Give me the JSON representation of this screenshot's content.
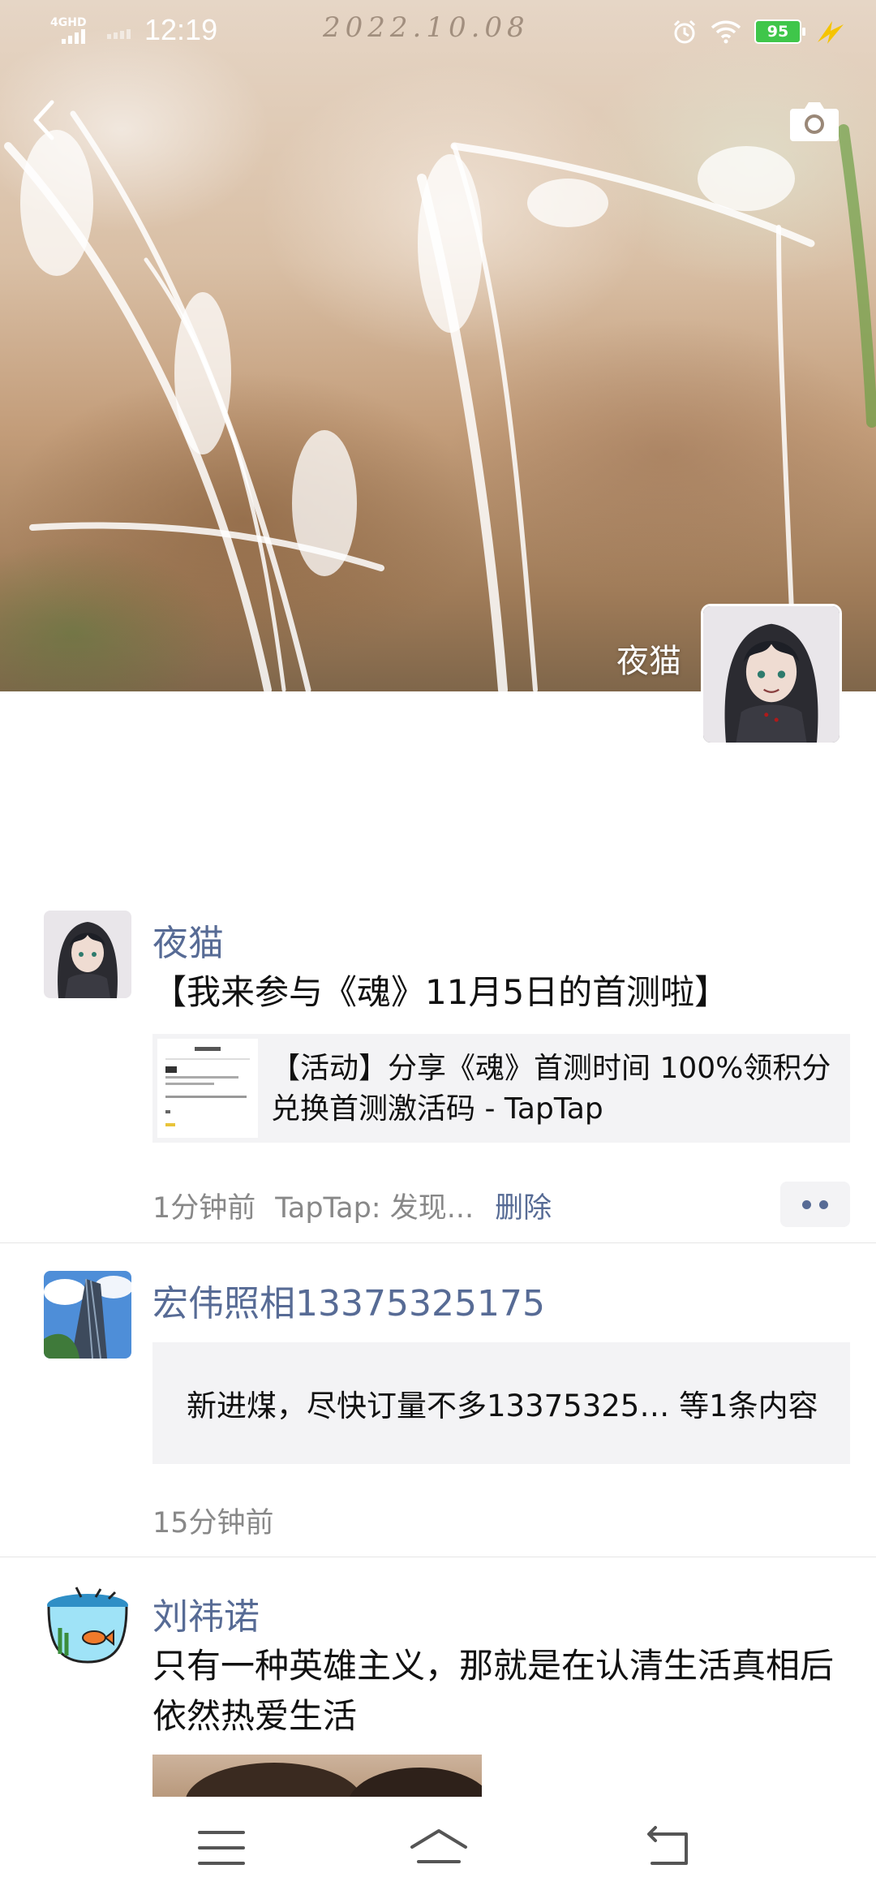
{
  "status_bar": {
    "network_type": "4GHD",
    "time": "12:19",
    "watermark_date": "2022.10.08",
    "battery_level": "95",
    "icons": [
      "signal-icon",
      "alarm-icon",
      "wifi-icon",
      "battery-icon",
      "charging-icon"
    ]
  },
  "header": {
    "back_icon": "chevron-left-icon",
    "camera_icon": "camera-icon",
    "owner_name": "夜猫"
  },
  "posts": [
    {
      "nickname": "夜猫",
      "text": "【我来参与《魂》11月5日的首测啦】",
      "link_card": {
        "title": "【活动】分享《魂》首测时间 100%领积分兑换首测激活码 - TapTap"
      },
      "time": "1分钟前",
      "source": "TapTap: 发现...",
      "delete_label": "删除"
    },
    {
      "nickname": "宏伟照相13375325175",
      "summary": "新进煤，尽快订量不多13375325… 等1条内容",
      "time": "15分钟前"
    },
    {
      "nickname": "刘祎诺",
      "text": "只有一种英雄主义，那就是在认清生活真相后依然热爱生活"
    }
  ],
  "nav_bar": {
    "icons": [
      "menu-icon",
      "home-icon",
      "back-icon"
    ]
  },
  "colors": {
    "nickname": "#576b95",
    "card_background": "#f3f3f5",
    "meta_text": "#888888",
    "battery": "#3fc64a"
  }
}
